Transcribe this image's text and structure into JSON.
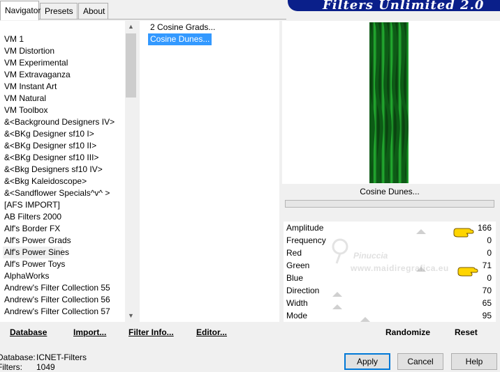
{
  "tabs": [
    {
      "label": "Navigator"
    },
    {
      "label": "Presets"
    },
    {
      "label": "About"
    }
  ],
  "banner": {
    "title": "Filters Unlimited 2.0"
  },
  "categories": [
    "VM 1",
    "VM Distortion",
    "VM Experimental",
    "VM Extravaganza",
    "VM Instant Art",
    "VM Natural",
    "VM Toolbox",
    "&<Background Designers IV>",
    "&<BKg Designer sf10 I>",
    "&<BKg Designer sf10 II>",
    "&<BKg Designer sf10 III>",
    "&<Bkg Designers sf10 IV>",
    "&<Bkg Kaleidoscope>",
    "&<Sandflower Specials^v^ >",
    "[AFS IMPORT]",
    "AB Filters 2000",
    "Alf's Border FX",
    "Alf's Power Grads",
    "Alf's Power Sines",
    "Alf's Power Toys",
    "AlphaWorks",
    "Andrew's Filter Collection 55",
    "Andrew's Filter Collection 56",
    "Andrew's Filter Collection 57"
  ],
  "selected_category": "Alf's Power Sines",
  "filters": [
    {
      "label": "2 Cosine Grads..."
    },
    {
      "label": "Cosine Dunes..."
    }
  ],
  "selected_filter": "Cosine Dunes...",
  "preview": {
    "filter_name": "Cosine Dunes..."
  },
  "params": [
    {
      "label": "Amplitude",
      "value": "166"
    },
    {
      "label": "Frequency",
      "value": "0"
    },
    {
      "label": "Red",
      "value": "0"
    },
    {
      "label": "Green",
      "value": "71"
    },
    {
      "label": "Blue",
      "value": "0"
    },
    {
      "label": "Direction",
      "value": "70"
    },
    {
      "label": "Width",
      "value": "65"
    },
    {
      "label": "Mode",
      "value": "95"
    }
  ],
  "watermark": {
    "name": "Pinuccia",
    "url": "www.maidiregrafica.eu"
  },
  "bottom_links": {
    "database": "Database",
    "import": "Import...",
    "filter_info": "Filter Info...",
    "editor": "Editor...",
    "randomize": "Randomize",
    "reset": "Reset"
  },
  "status": {
    "database_label": "Database:",
    "database_value": "ICNET-Filters",
    "filters_label": "Filters:",
    "filters_value": "1049"
  },
  "dialog": {
    "apply": "Apply",
    "cancel": "Cancel",
    "help": "Help"
  },
  "colors": {
    "banner": "#0a1f8a",
    "selection": "#3399ff",
    "preview_green": "#1fa82c"
  }
}
